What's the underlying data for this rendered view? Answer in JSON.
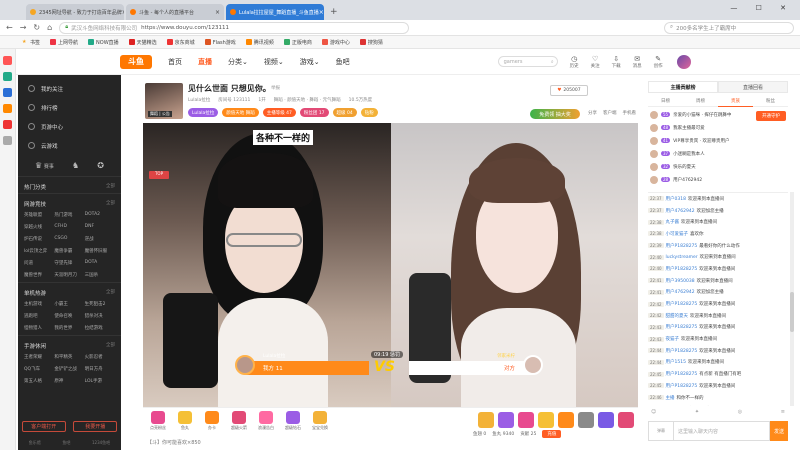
{
  "browser": {
    "tabs": [
      {
        "label": "2345网址导航 - 致力于打造百年品牌",
        "color": "#f5a623"
      },
      {
        "label": "斗鱼 - 每个人的直播平台",
        "color": "#ff7700"
      },
      {
        "label": "Lulala拉拉屋屋_舞蹈直播_斗鱼直播",
        "color": "#ff7700"
      }
    ],
    "url_host": "武汉斗鱼网络科技有限公司",
    "url": "https://www.douyu.com/123111",
    "search_placeholder": "200多名学生上了霸席中",
    "bookmarks": [
      "书签",
      "上网导航",
      "NOW直播",
      "天猫精选",
      "京东商城",
      "Flash游戏",
      "腾讯视频",
      "正版电商",
      "游戏中心",
      "搜狗猜"
    ]
  },
  "site": {
    "logo": "斗鱼",
    "nav": [
      "首页",
      "直播",
      "分类",
      "视频",
      "游戏",
      "鱼吧"
    ],
    "search_placeholder": "gamers",
    "header_icons": [
      "历史",
      "关注",
      "下载",
      "消息",
      "创作"
    ]
  },
  "sidebar": {
    "items": [
      "我的关注",
      "排行榜",
      "页游中心",
      "云游戏",
      "赛事"
    ],
    "hot_title": "热门分类",
    "more": "全部",
    "sections": [
      {
        "title": "网游竞技",
        "items": [
          "英雄联盟",
          "热门游戏",
          "DOTA2",
          "穿越火线",
          "CFHD",
          "DNF",
          "炉石传说",
          "CSGO",
          "逆战",
          "lol云顶之弈",
          "魔兽争霸",
          "魔兽怀旧服",
          "问道",
          "守望先锋",
          "DOTA",
          "魔兽世界",
          "天涯明月刀",
          "三国杀"
        ]
      },
      {
        "title": "单机热游",
        "items": [
          "主机游戏",
          "小霸王",
          "生死狙击2",
          "逃跑吧",
          "使命召唤",
          "猎杀对决",
          "怪物猎人",
          "我的世界",
          "拉结游戏"
        ]
      },
      {
        "title": "手游休闲",
        "items": [
          "王者荣耀",
          "和平精英",
          "火影忍者",
          "QQ飞车",
          "金铲铲之战",
          "明日方舟",
          "第五人格",
          "原神",
          "LOL手游"
        ]
      }
    ],
    "icons_label": "赛事",
    "btn_download": "客户端打开",
    "btn_stream": "我要开播",
    "footer": [
      "鱼乐馆",
      "鱼吧",
      "1234鱼吧"
    ]
  },
  "room": {
    "title": "见什么世面 只想见你。",
    "category": "舞蹈 · 颜值天地 · 舞蹈 · 元气舞蹈",
    "anchor": "Lulala拉拉",
    "room_id": "房间号 123111",
    "level": "1开",
    "report": "举报",
    "hot": "10.5万热度",
    "badges": [
      {
        "label": "Lulala拉拉",
        "color": "#9b5de5"
      },
      {
        "label": "颜值天地 舞蹈",
        "color": "#ff8a1a"
      },
      {
        "label": "主播等级 47",
        "color": "#ff5d23"
      },
      {
        "label": "粉丝团 17",
        "color": "#e24a76"
      },
      {
        "label": "超级 04",
        "color": "#f0a030"
      },
      {
        "label": "钻粉",
        "color": "#f3b238"
      }
    ],
    "follow": "205007",
    "free_gift": "免费领 抽大奖",
    "side_actions": [
      "分享",
      "客户端",
      "手机看"
    ],
    "anchor_pic_label": "舞蹈 | 公告"
  },
  "video": {
    "caption": "各种不一样的",
    "top_tag": "TOP",
    "pk": {
      "left_name": "Lulala拉拉",
      "left_label": "我方 11",
      "right_name": "邻家米柠",
      "right_label": "对方",
      "vs": "VS",
      "timer": "09:19 惩罚"
    }
  },
  "giftbar": {
    "gifts": [
      {
        "label": "点亮粉丝",
        "color": "#e84a8f"
      },
      {
        "label": "鱼丸",
        "color": "#f5c036"
      },
      {
        "label": "办卡",
        "color": "#ff8a1a"
      },
      {
        "label": "超级火箭",
        "color": "#e24a76"
      },
      {
        "label": "浪漫告白",
        "color": "#ff6aa2"
      },
      {
        "label": "超级钻石",
        "color": "#9b5de5"
      },
      {
        "label": "宝宝兑换",
        "color": "#f3b238"
      }
    ],
    "right_icons": [
      "#f3b238",
      "#9b5de5",
      "#e84a8f",
      "#f5c036",
      "#ff8a1a",
      "#8a8a8a",
      "#7a5ae5",
      "#e24a76"
    ],
    "danmu": "【斗】你可能喜欢×850",
    "balance": [
      "鱼翅 0",
      "鱼丸 9340",
      "贡献 25"
    ],
    "recharge": "充值"
  },
  "rank": {
    "head": [
      "主播贡献榜",
      "直播回看"
    ],
    "tabs": [
      "日榜",
      "周榜",
      "贵族",
      "粉丝"
    ],
    "open_guard": "开通守护",
    "list": [
      {
        "name": "亲爱的小猫咪 · 挥仔在跳舞中",
        "level": "55"
      },
      {
        "name": "我家主播最可爱",
        "level": "48"
      },
      {
        "name": "VIP尊享贵宾 · 欢迎尊贵用户",
        "level": "41"
      },
      {
        "name": "小迷糊是我本人",
        "level": "37"
      },
      {
        "name": "快乐的夏天",
        "level": "32"
      },
      {
        "name": "用户4762942",
        "level": "28"
      }
    ]
  },
  "chat": {
    "messages": [
      {
        "t": "22:37",
        "u": "用户0318",
        "m": "欢迎来到本直播间"
      },
      {
        "t": "22:37",
        "u": "用户4762942",
        "m": "欢迎加您主播"
      },
      {
        "t": "22:38",
        "u": "丸子酱",
        "m": "欢迎来到本直播间"
      },
      {
        "t": "22:38",
        "u": "小可爱猫子",
        "m": "喜欢你"
      },
      {
        "t": "22:39",
        "u": "用户P1828275",
        "m": "最看好你的什么动作"
      },
      {
        "t": "22:40",
        "u": "luckystreamer",
        "m": "欢迎来到本直播间"
      },
      {
        "t": "22:40",
        "u": "用户P1828275",
        "m": "欢迎来到本直播间"
      },
      {
        "t": "22:41",
        "u": "用户3950038",
        "m": "欢迎来到本直播间"
      },
      {
        "t": "22:41",
        "u": "用户4762942",
        "m": "欢迎加您主播"
      },
      {
        "t": "22:42",
        "u": "用户P1828275",
        "m": "欢迎来到本直播间"
      },
      {
        "t": "22:42",
        "u": "甜甜的夏天",
        "m": "欢迎来到本直播间"
      },
      {
        "t": "22:43",
        "u": "用户P1828275",
        "m": "欢迎来到本直播间"
      },
      {
        "t": "22:43",
        "u": "夜猫子",
        "m": "欢迎来到本直播间"
      },
      {
        "t": "22:44",
        "u": "用户P1828275",
        "m": "欢迎来到本直播间"
      },
      {
        "t": "22:44",
        "u": "用户1515",
        "m": "欢迎来到本直播间"
      },
      {
        "t": "22:45",
        "u": "用户P1828275",
        "m": "有点新 有直播门有吧"
      },
      {
        "t": "22:45",
        "u": "用户P1828275",
        "m": "欢迎来到本直播间"
      },
      {
        "t": "22:46",
        "u": "主播",
        "m": "和你不一样的"
      },
      {
        "t": "22:46",
        "u": "winkao",
        "m": "欢迎来到本直播间"
      },
      {
        "t": "22:47",
        "u": "用户sakura",
        "m": "欢迎来到本直播间"
      }
    ],
    "tools": [
      "☺",
      "✦",
      "◎",
      "≡"
    ],
    "input_prefix": "弹幕",
    "placeholder": "这里输入聊天内容",
    "send": "发送"
  }
}
